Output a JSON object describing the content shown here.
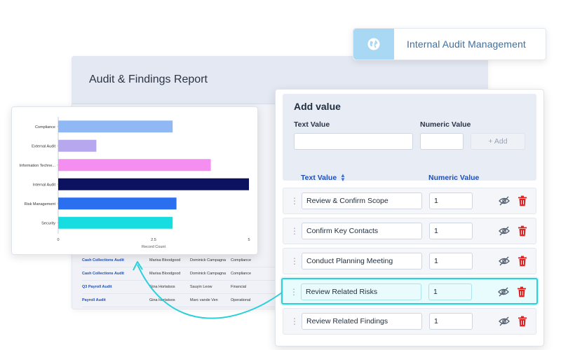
{
  "report": {
    "title": "Audit & Findings Report",
    "rows": [
      {
        "name": "Cash Collections Audit",
        "owner": "Marisa Bloodgood",
        "reviewer": "Dominick Campagna",
        "type": "Compliance"
      },
      {
        "name": "Cash Collections Audit",
        "owner": "Marisa Bloodgood",
        "reviewer": "Dominick Campagna",
        "type": "Compliance"
      },
      {
        "name": "Q3 Payroll Audit",
        "owner": "Gina Hortatsos",
        "reviewer": "Sauyin Leow",
        "type": "Financial"
      },
      {
        "name": "Payroll Audit",
        "owner": "Gina Hortatsos",
        "reviewer": "Marc vande Ven",
        "type": "Operational"
      }
    ]
  },
  "badge": {
    "label": "Internal Audit Management",
    "icon": "globe-icon",
    "color": "#a8d8f4"
  },
  "chart_data": {
    "type": "bar",
    "orientation": "horizontal",
    "categories": [
      "Compliance",
      "External Audit",
      "Information Techne...",
      "Internal Audit",
      "Risk Management",
      "Security"
    ],
    "values": [
      3,
      1,
      4,
      5,
      3.1,
      3
    ],
    "colors": [
      "#8fb8f4",
      "#b7a7ee",
      "#f48ef0",
      "#0c1160",
      "#2a6ff0",
      "#17dde0"
    ],
    "xlabel": "Record Count",
    "ylabel": "",
    "title": "",
    "xlim": [
      0,
      5
    ],
    "xticks": [
      "0",
      "2.5",
      "5"
    ],
    "grid": false
  },
  "panel": {
    "title": "Add value",
    "text_label": "Text Value",
    "numeric_label": "Numeric Value",
    "text_value": "",
    "numeric_value": "",
    "add_button": "+ Add",
    "col_text": "Text Value",
    "col_numeric": "Numeric Value",
    "highlight_color": "#2cd0d8",
    "rows": [
      {
        "text": "Review & Confirm Scope",
        "num": "1"
      },
      {
        "text": "Confirm Key Contacts",
        "num": "1"
      },
      {
        "text": "Conduct Planning Meeting",
        "num": "1"
      },
      {
        "text": "Review Related Risks",
        "num": "1",
        "highlighted": true
      },
      {
        "text": "Review Related Findings",
        "num": "1"
      }
    ]
  }
}
